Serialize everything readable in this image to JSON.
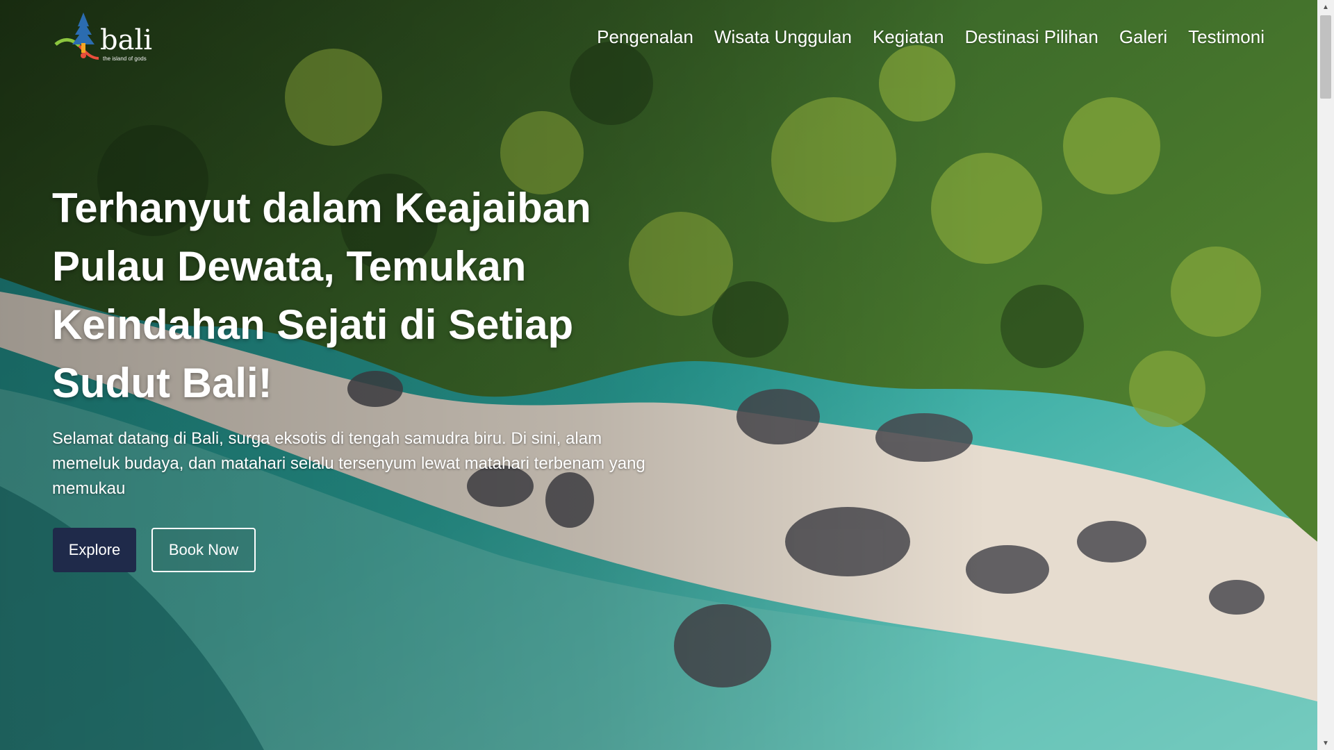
{
  "brand": {
    "logo_word": "bali",
    "logo_tagline": "the island of gods"
  },
  "nav": {
    "items": [
      {
        "label": "Pengenalan"
      },
      {
        "label": "Wisata Unggulan"
      },
      {
        "label": "Kegiatan"
      },
      {
        "label": "Destinasi Pilihan"
      },
      {
        "label": "Galeri"
      },
      {
        "label": "Testimoni"
      }
    ]
  },
  "hero": {
    "headline": "Terhanyut dalam Keajaiban Pulau Dewata, Temukan Keindahan Sejati di Setiap Sudut Bali!",
    "subtext": "Selamat datang di Bali, surga eksotis di tengah samudra biru. Di sini, alam memeluk budaya, dan matahari selalu tersenyum lewat matahari terbenam yang memukau",
    "buttons": {
      "explore": "Explore",
      "book_now": "Book Now"
    },
    "background_image": "aerial-beach-forest"
  },
  "colors": {
    "primary_button": "#1f2a4a",
    "text": "#ffffff",
    "forest": "#3d6b2a",
    "sand": "#e6dccf",
    "sea": "#2aa39a"
  },
  "icons": {
    "logo": "bali-temple-logo-icon",
    "scroll_up": "scroll-up-arrow-icon",
    "scroll_down": "scroll-down-arrow-icon"
  }
}
